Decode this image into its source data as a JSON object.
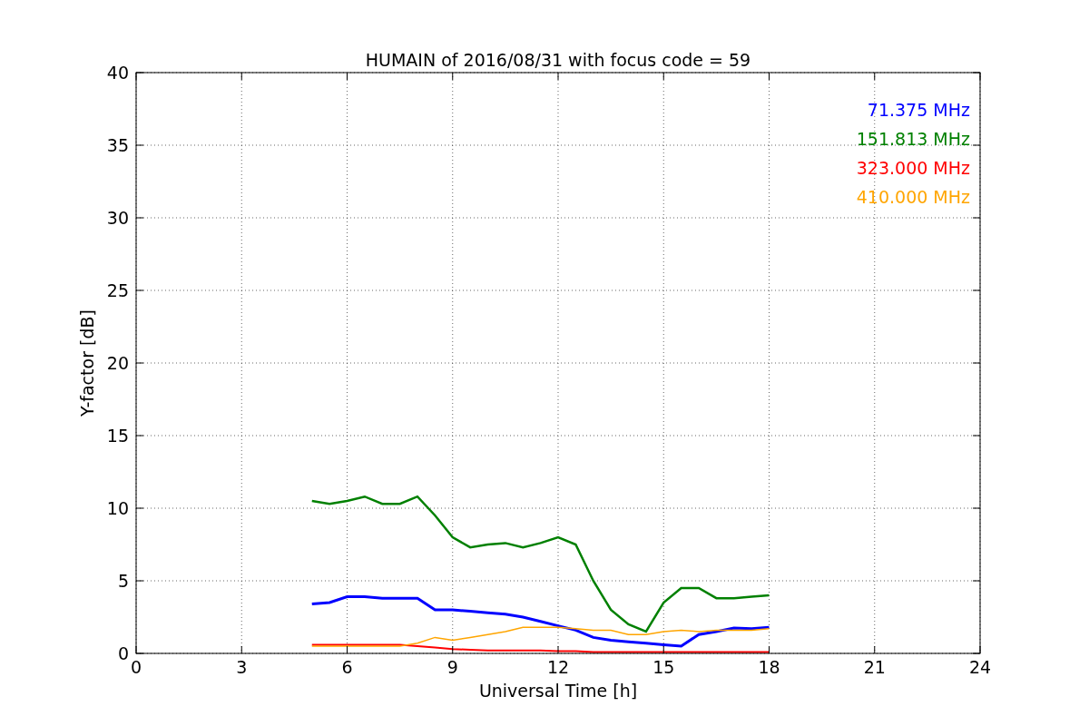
{
  "figure": {
    "chart_data": {
      "type": "line",
      "title": "HUMAIN of 2016/08/31 with focus code = 59",
      "xlabel": "Universal Time [h]",
      "ylabel": "Y-factor [dB]",
      "x": [
        5,
        5.5,
        6,
        6.5,
        7,
        7.5,
        8,
        8.5,
        9,
        9.5,
        10,
        10.5,
        11,
        11.5,
        12,
        12.5,
        13,
        13.5,
        14,
        14.5,
        15,
        15.5,
        16,
        16.5,
        17,
        17.5,
        18
      ],
      "series": [
        {
          "name": "71.375 MHz",
          "color": "#0000ff",
          "values": [
            3.4,
            3.5,
            3.9,
            3.9,
            3.8,
            3.8,
            3.8,
            3.0,
            3.0,
            2.9,
            2.8,
            2.7,
            2.5,
            2.2,
            1.9,
            1.6,
            1.1,
            0.9,
            0.8,
            0.7,
            0.6,
            0.5,
            1.3,
            1.5,
            1.75,
            1.7,
            1.8
          ]
        },
        {
          "name": "151.813 MHz",
          "color": "#008000",
          "values": [
            10.5,
            10.3,
            10.5,
            10.8,
            10.3,
            10.3,
            10.8,
            9.5,
            8.0,
            7.3,
            7.5,
            7.6,
            7.3,
            7.6,
            8.0,
            7.5,
            5.0,
            3.0,
            2.0,
            1.5,
            3.5,
            4.5,
            4.5,
            3.8,
            3.8,
            3.9,
            4.0
          ]
        },
        {
          "name": "323.000 MHz",
          "color": "#ff0000",
          "values": [
            0.6,
            0.6,
            0.6,
            0.6,
            0.6,
            0.6,
            0.5,
            0.4,
            0.3,
            0.25,
            0.2,
            0.2,
            0.2,
            0.2,
            0.15,
            0.15,
            0.1,
            0.1,
            0.1,
            0.1,
            0.1,
            0.1,
            0.1,
            0.1,
            0.1,
            0.1,
            0.1
          ]
        },
        {
          "name": "410.000 MHz",
          "color": "#ffa500",
          "values": [
            0.5,
            0.5,
            0.5,
            0.5,
            0.5,
            0.5,
            0.7,
            1.1,
            0.9,
            1.1,
            1.3,
            1.5,
            1.8,
            1.8,
            1.8,
            1.7,
            1.6,
            1.6,
            1.3,
            1.3,
            1.5,
            1.6,
            1.5,
            1.6,
            1.6,
            1.6,
            1.7
          ]
        }
      ],
      "xlim": [
        0,
        24
      ],
      "ylim": [
        0,
        40
      ],
      "xticks": [
        0,
        3,
        6,
        9,
        12,
        15,
        18,
        21,
        24
      ],
      "yticks": [
        0,
        5,
        10,
        15,
        20,
        25,
        30,
        35,
        40
      ],
      "grid": true
    }
  }
}
